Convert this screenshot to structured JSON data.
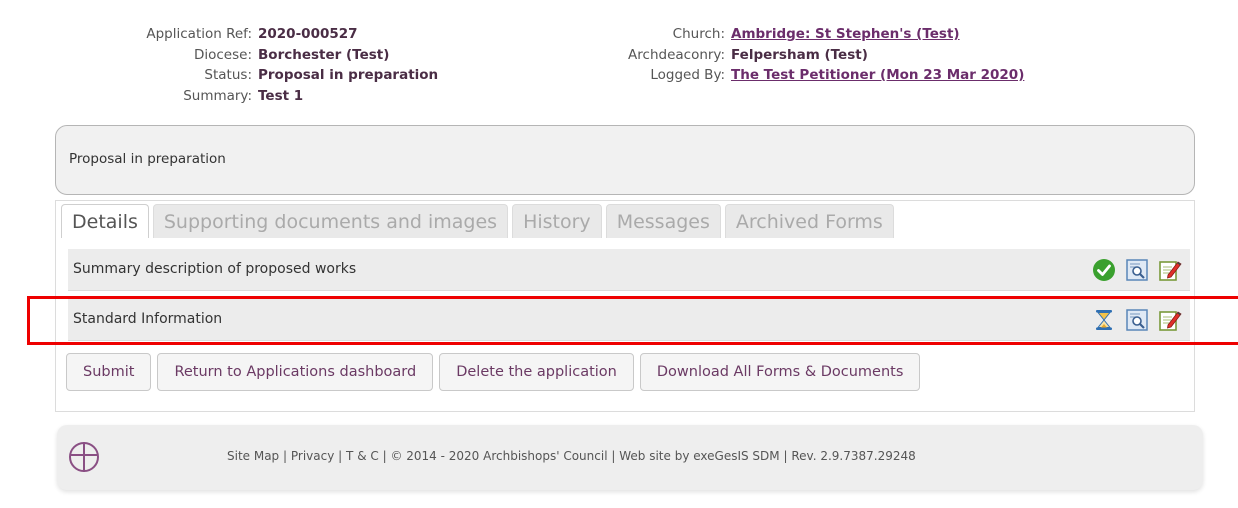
{
  "application": {
    "left": [
      {
        "label": "Application Ref:",
        "value": "2020-000527"
      },
      {
        "label": "Diocese:",
        "value": "Borchester (Test)"
      },
      {
        "label": "Status:",
        "value": "Proposal in preparation"
      },
      {
        "label": "Summary:",
        "value": "Test 1"
      }
    ],
    "right": [
      {
        "label": "Church:",
        "value": "Ambridge: St Stephen's (Test)"
      },
      {
        "label": "Archdeaconry:",
        "value": "Felpersham (Test)"
      },
      {
        "label": "Logged By:",
        "value": "The Test Petitioner (Mon 23 Mar 2020)"
      }
    ]
  },
  "status_box": {
    "text": "Proposal in preparation"
  },
  "tabs": [
    {
      "label": "Details",
      "active": true
    },
    {
      "label": "Supporting documents and images"
    },
    {
      "label": "History"
    },
    {
      "label": "Messages"
    },
    {
      "label": "Archived Forms"
    }
  ],
  "forms": [
    {
      "label": "Summary description of proposed works",
      "status_icon": "check-icon"
    },
    {
      "label": "Standard Information",
      "status_icon": "hourglass-icon"
    }
  ],
  "buttons": {
    "submit": "Submit",
    "return": "Return to Applications dashboard",
    "delete": "Delete the application",
    "download": "Download All Forms & Documents"
  },
  "footer": {
    "site_map": "Site Map",
    "privacy": "Privacy",
    "tc": "T & C",
    "copyright": "© 2014 - 2020 Archbishops' Council",
    "credit": "Web site by exeGesIS SDM",
    "rev": "Rev. 2.9.7387.29248",
    "separator": "|"
  },
  "colors": {
    "accent": "#6b2d6b",
    "highlight": "#ee0000",
    "check": "#3aa02e"
  }
}
